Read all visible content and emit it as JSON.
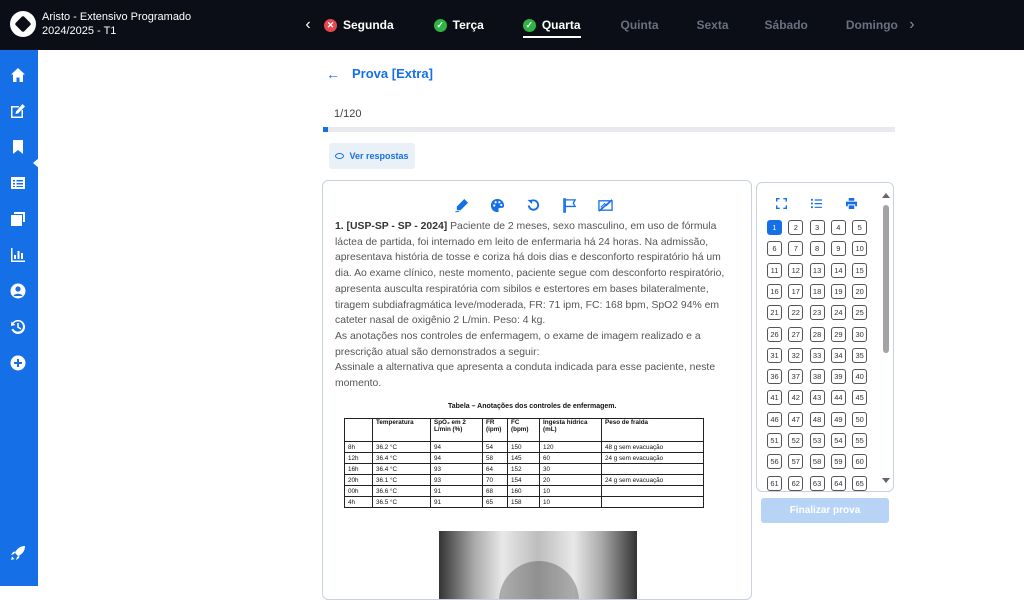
{
  "app": {
    "title_line1": "Aristo - Extensivo Programado",
    "title_line2": "2024/2025 - T1"
  },
  "days": [
    {
      "label": "Segunda",
      "status": "error"
    },
    {
      "label": "Terça",
      "status": "done"
    },
    {
      "label": "Quarta",
      "status": "done",
      "active": true
    },
    {
      "label": "Quinta",
      "status": "none"
    },
    {
      "label": "Sexta",
      "status": "none"
    },
    {
      "label": "Sábado",
      "status": "none"
    },
    {
      "label": "Domingo",
      "status": "none"
    }
  ],
  "sidebar": {
    "items": [
      "home-icon",
      "edit-icon",
      "bookmark-icon",
      "list-icon",
      "cards-icon",
      "chart-icon",
      "user-icon",
      "history-icon",
      "add-icon",
      "rocket-icon"
    ],
    "active": "edit-icon"
  },
  "exam": {
    "title": "Prova [Extra]",
    "progress_text": "1/120",
    "progress_fraction": 0.0083,
    "show_answers": "Ver respostas"
  },
  "question": {
    "tools": [
      "highlighter-icon",
      "palette-icon",
      "undo-icon",
      "flag-icon",
      "strike-icon"
    ],
    "code": "1. [USP-SP - SP - 2024]",
    "p1": "Paciente de 2 meses, sexo masculino, em uso de fórmula láctea de partida, foi internado em leito de enfermaria há 24 horas. Na admissão, apresentava história de tosse e coriza há dois dias e desconforto respiratório há um dia. Ao exame clínico, neste momento, paciente segue com desconforto respiratório, apresenta ausculta respiratória com sibilos e estertores em bases bilateralmente, tiragem subdiafragmática leve/moderada, FR: 71 ipm, FC: 168 bpm, SpO2 94% em cateter nasal de oxigênio 2 L/min. Peso: 4 kg.",
    "p2": "As anotações nos controles de enfermagem, o exame de imagem realizado e a prescrição atual são demonstrados a seguir:",
    "p3": "Assinale a alternativa que apresenta a conduta indicada para esse paciente, neste momento.",
    "table_title": "Tabela – Anotações dos controles de enfermagem.",
    "table_headers": [
      "",
      "Temperatura",
      "SpO₂ em 2 L/min (%)",
      "FR (ipm)",
      "FC (bpm)",
      "Ingesta hídrica (mL)",
      "Peso de fralda"
    ],
    "table_rows": [
      [
        "8h",
        "36.2 °C",
        "94",
        "54",
        "150",
        "120",
        "48 g sem evacuação"
      ],
      [
        "12h",
        "36.4 °C",
        "94",
        "58",
        "145",
        "60",
        "24 g sem evacuação"
      ],
      [
        "16h",
        "36.4 °C",
        "93",
        "64",
        "152",
        "30",
        ""
      ],
      [
        "20h",
        "36.1 °C",
        "93",
        "70",
        "154",
        "20",
        "24 g sem evacuação"
      ],
      [
        "00h",
        "36.6 °C",
        "91",
        "68",
        "160",
        "10",
        ""
      ],
      [
        "4h",
        "36.5 °C",
        "91",
        "65",
        "158",
        "10",
        ""
      ]
    ]
  },
  "navigator": {
    "tools": [
      "expand-icon",
      "checklist-icon",
      "print-icon"
    ],
    "numbers": [
      "1",
      "2",
      "3",
      "4",
      "5",
      "6",
      "7",
      "8",
      "9",
      "10",
      "11",
      "12",
      "13",
      "14",
      "15",
      "16",
      "17",
      "18",
      "19",
      "20",
      "21",
      "22",
      "23",
      "24",
      "25",
      "26",
      "27",
      "28",
      "29",
      "30",
      "31",
      "32",
      "33",
      "34",
      "35",
      "36",
      "37",
      "38",
      "39",
      "40",
      "41",
      "42",
      "43",
      "44",
      "45",
      "46",
      "47",
      "48",
      "49",
      "50",
      "51",
      "52",
      "53",
      "54",
      "55",
      "56",
      "57",
      "58",
      "59",
      "60",
      "61",
      "62",
      "63",
      "64",
      "65"
    ],
    "current": "1",
    "finish_label": "Finalizar prova"
  }
}
